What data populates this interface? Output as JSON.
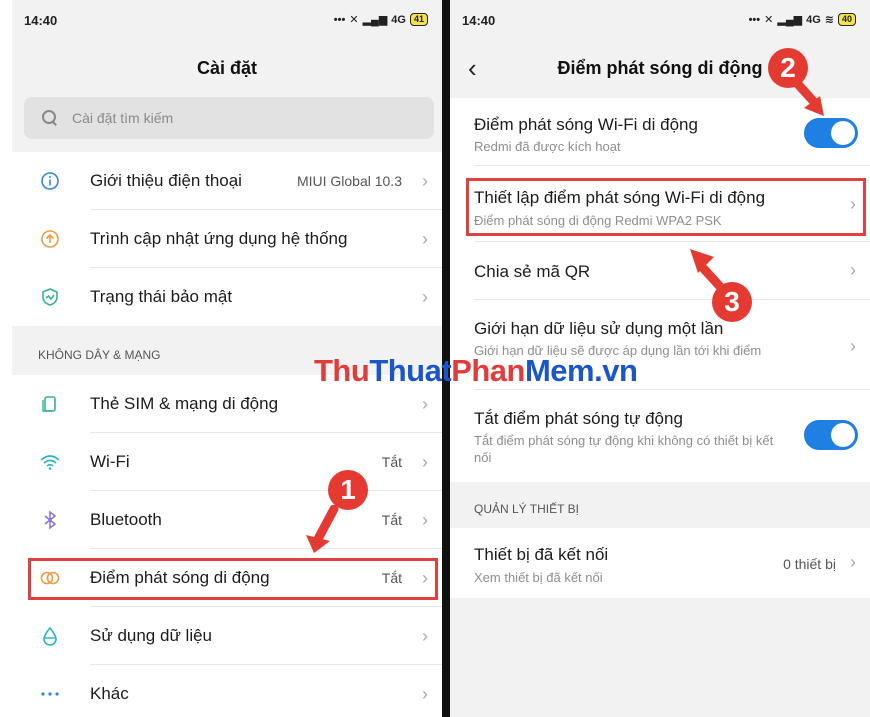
{
  "left": {
    "status": {
      "time": "14:40",
      "network": "4G",
      "battery": "41"
    },
    "title": "Cài đặt",
    "search": {
      "placeholder": "Cài đặt tìm kiếm"
    },
    "group1": [
      {
        "label": "Giới thiệu điện thoại",
        "value": "MIUI Global 10.3",
        "icon": "info-icon"
      },
      {
        "label": "Trình cập nhật ứng dụng hệ thống",
        "value": "",
        "icon": "update-icon"
      },
      {
        "label": "Trạng thái bảo mật",
        "value": "",
        "icon": "shield-icon"
      }
    ],
    "section_title": "KHÔNG DÂY & MẠNG",
    "group2": [
      {
        "label": "Thẻ SIM & mạng di động",
        "value": "",
        "icon": "sim-icon"
      },
      {
        "label": "Wi-Fi",
        "value": "Tắt",
        "icon": "wifi-icon"
      },
      {
        "label": "Bluetooth",
        "value": "Tắt",
        "icon": "bluetooth-icon"
      },
      {
        "label": "Điểm phát sóng di động",
        "value": "Tắt",
        "icon": "hotspot-icon"
      },
      {
        "label": "Sử dụng dữ liệu",
        "value": "",
        "icon": "data-usage-icon"
      },
      {
        "label": "Khác",
        "value": "",
        "icon": "more-icon"
      }
    ]
  },
  "right": {
    "status": {
      "time": "14:40",
      "network": "4G",
      "battery": "40"
    },
    "title": "Điểm phát sóng di động",
    "rows": [
      {
        "title": "Điểm phát sóng Wi-Fi di động",
        "subtitle": "Redmi đã được kích hoạt"
      },
      {
        "title": "Thiết lập điểm phát sóng Wi-Fi di động",
        "subtitle": "Điểm phát sóng di động Redmi WPA2 PSK"
      },
      {
        "title": "Chia sẻ mã QR",
        "subtitle": ""
      },
      {
        "title": "Giới hạn dữ liệu sử dụng một lần",
        "subtitle": "Giới hạn dữ liệu sẽ được áp dụng lần tới khi điểm"
      },
      {
        "title": "Tắt điểm phát sóng tự động",
        "subtitle": "Tắt điểm phát sóng tự động khi không có thiết bị kết nối"
      }
    ],
    "section_title": "QUẢN LÝ THIẾT BỊ",
    "devices": {
      "title": "Thiết bị đã kết nối",
      "subtitle": "Xem thiết bị đã kết nối",
      "value": "0 thiết bị"
    }
  },
  "annotations": {
    "step1": "1",
    "step2": "2",
    "step3": "3"
  },
  "watermark": {
    "part1": "Thu",
    "part2": "Thuat",
    "part3": "Phan",
    "part4": "Mem.vn"
  },
  "colors": {
    "accent": "#1f7fe2",
    "highlight": "#e0403f"
  }
}
